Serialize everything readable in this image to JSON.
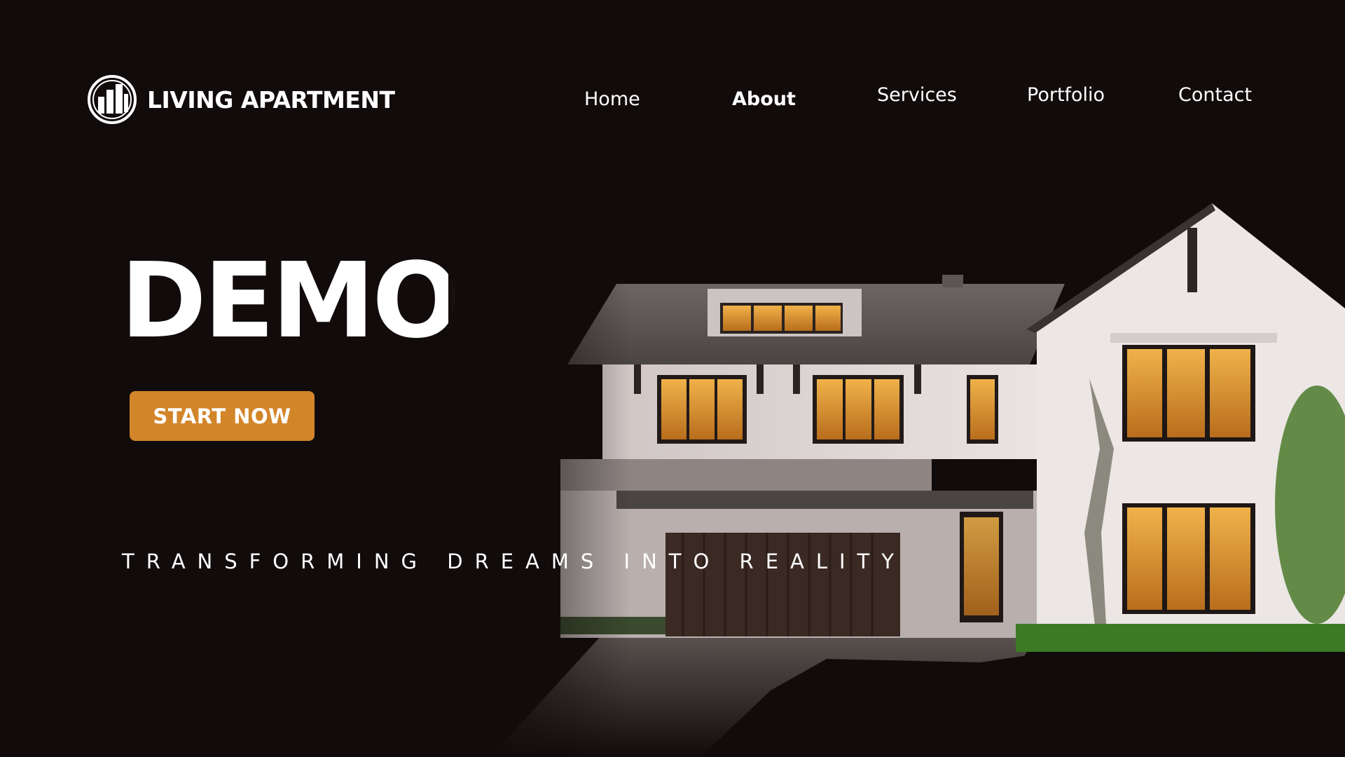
{
  "brand": {
    "name": "LIVING APARTMENT",
    "logo_icon": "building-logo-icon"
  },
  "nav": {
    "items": [
      {
        "label": "Home",
        "active": false
      },
      {
        "label": "About",
        "active": true
      },
      {
        "label": "Services",
        "active": false
      },
      {
        "label": "Portfolio",
        "active": false
      },
      {
        "label": "Contact",
        "active": false
      }
    ]
  },
  "hero": {
    "title": "DEMO",
    "cta_label": "START NOW",
    "tagline": "TRANSFORMING DREAMS INTO REALITY",
    "image": "house-photo"
  },
  "colors": {
    "background": "#110c0b",
    "accent": "#d3852a",
    "text": "#ffffff",
    "window_glow": "#e8a43a"
  }
}
